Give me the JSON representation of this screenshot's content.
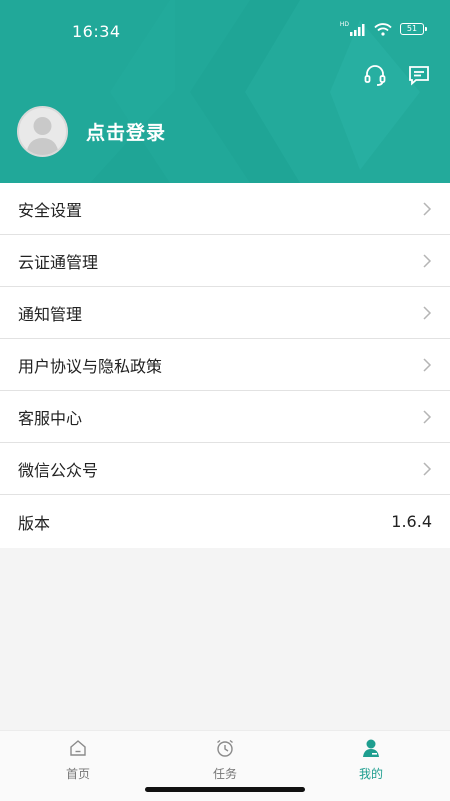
{
  "status_bar": {
    "time": "16:34",
    "network": "HD",
    "battery": "51"
  },
  "colors": {
    "header": "#1fa596",
    "accent": "#1e9e8f"
  },
  "header": {
    "actions": [
      {
        "icon": "headset-icon"
      },
      {
        "icon": "message-icon"
      }
    ],
    "login_label": "点击登录"
  },
  "menu": {
    "items": [
      {
        "label": "安全设置"
      },
      {
        "label": "云证通管理"
      },
      {
        "label": "通知管理"
      },
      {
        "label": "用户协议与隐私政策"
      },
      {
        "label": "客服中心"
      },
      {
        "label": "微信公众号"
      }
    ],
    "version": {
      "label": "版本",
      "value": "1.6.4"
    }
  },
  "tabbar": {
    "tabs": [
      {
        "label": "首页",
        "icon": "home-icon",
        "active": false
      },
      {
        "label": "任务",
        "icon": "alarm-clock-icon",
        "active": false
      },
      {
        "label": "我的",
        "icon": "user-icon",
        "active": true
      }
    ]
  }
}
